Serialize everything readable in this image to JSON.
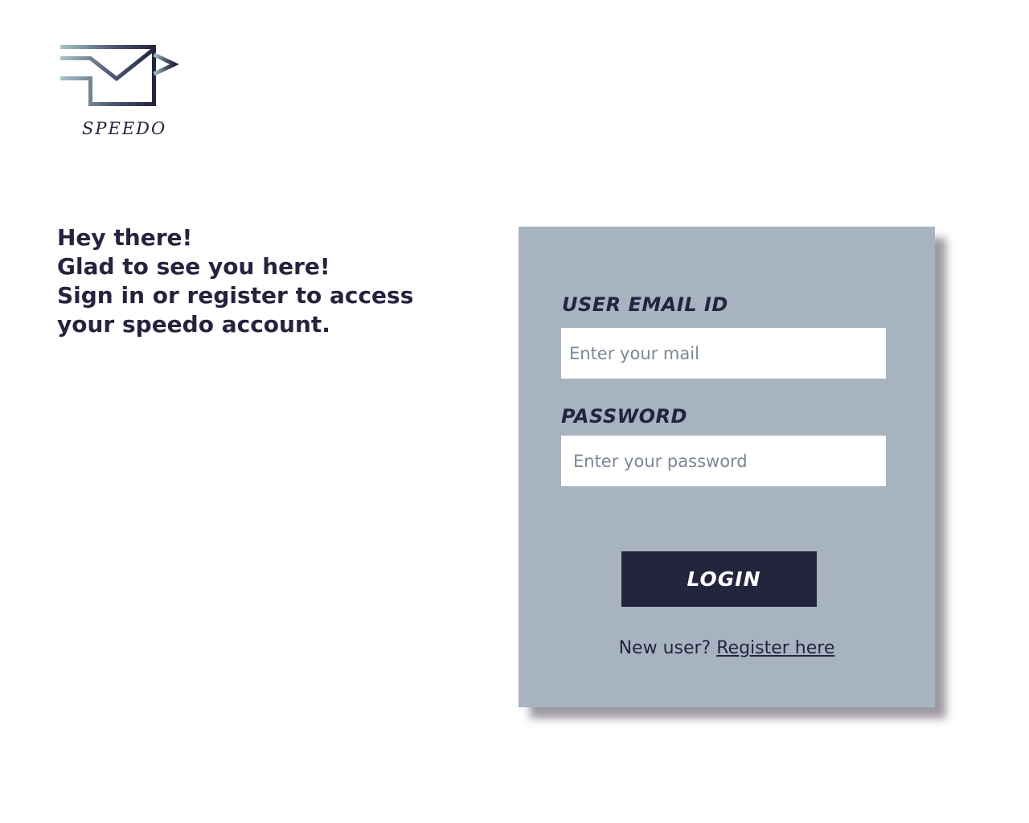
{
  "brand": {
    "name": "SPEEDO",
    "logo_icon": "envelope-speed-icon"
  },
  "welcome": {
    "line1": "Hey there!",
    "line2": "Glad to see you here!",
    "line3": "Sign in or register to access your speedo account."
  },
  "login_form": {
    "email_label": "USER EMAIL ID",
    "email_placeholder": "Enter your mail",
    "email_value": "",
    "password_label": "PASSWORD",
    "password_placeholder": "Enter your password",
    "password_value": "",
    "login_label": "LOGIN",
    "new_user_text": "New user?",
    "register_label": "Register here"
  },
  "colors": {
    "primary": "#24243f",
    "card_background": "#a8b3c0",
    "page_background": "#ffffff",
    "logo_gradient_start": "#a7c4cc"
  }
}
